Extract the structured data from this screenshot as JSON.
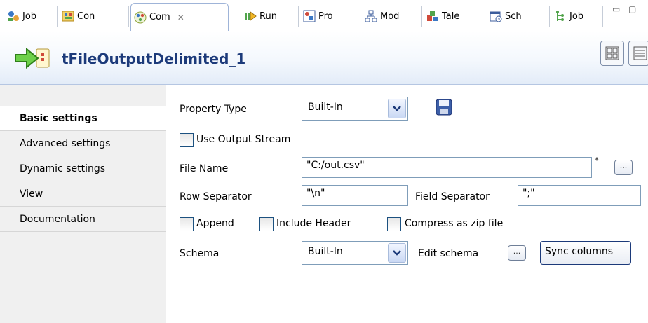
{
  "tabs": [
    {
      "label": "Job",
      "icon": "job-design-icon"
    },
    {
      "label": "Con",
      "icon": "contexts-icon"
    },
    {
      "label": "Com",
      "icon": "component-icon",
      "active": true
    },
    {
      "label": "Run",
      "icon": "run-icon"
    },
    {
      "label": "Pro",
      "icon": "problems-icon"
    },
    {
      "label": "Mod",
      "icon": "modules-icon"
    },
    {
      "label": "Tale",
      "icon": "talend-exchange-icon"
    },
    {
      "label": "Sch",
      "icon": "scheduler-icon"
    },
    {
      "label": "Job",
      "icon": "job-hierarchy-icon"
    }
  ],
  "tab_close_glyph": "✕",
  "window_controls": {
    "minimize": "▭",
    "maximize": "▢"
  },
  "component": {
    "title": "tFileOutputDelimited_1",
    "icon": "file-output-arrow-icon"
  },
  "sidebar": {
    "items": [
      {
        "label": "Basic settings",
        "active": true
      },
      {
        "label": "Advanced settings"
      },
      {
        "label": "Dynamic settings"
      },
      {
        "label": "View"
      },
      {
        "label": "Documentation"
      }
    ]
  },
  "form": {
    "property_type_label": "Property Type",
    "property_type_value": "Built-In",
    "save_icon": "save-disk-icon",
    "use_output_stream_label": "Use Output Stream",
    "use_output_stream_checked": false,
    "file_name_label": "File Name",
    "file_name_value": "\"C:/out.csv\"",
    "required_marker": "*",
    "browse_label": "...",
    "row_separator_label": "Row Separator",
    "row_separator_value": "\"\\n\"",
    "field_separator_label": "Field Separator",
    "field_separator_value": "\";\"",
    "append_label": "Append",
    "append_checked": false,
    "include_header_label": "Include Header",
    "include_header_checked": false,
    "compress_label": "Compress as zip file",
    "compress_checked": false,
    "schema_label": "Schema",
    "schema_value": "Built-In",
    "edit_schema_label": "Edit schema",
    "edit_schema_button": "...",
    "sync_columns_label": "Sync columns"
  },
  "colors": {
    "title": "#1c3a7a",
    "header_gradient_end": "#e3ecf8",
    "sidebar_bg": "#f0f0f0"
  }
}
